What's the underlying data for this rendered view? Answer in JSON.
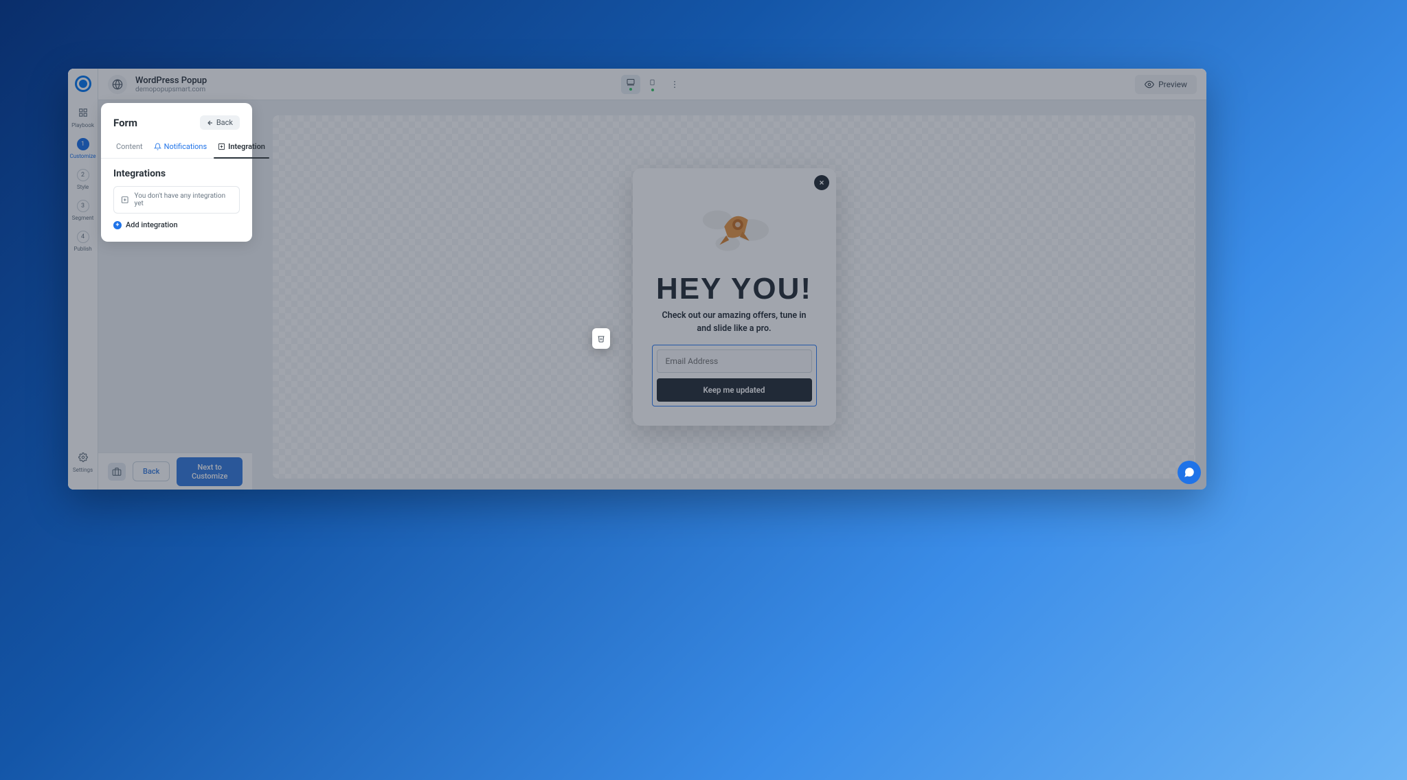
{
  "header": {
    "title": "WordPress Popup",
    "subtitle": "demopopupsmart.com",
    "preview": "Preview"
  },
  "rail": {
    "playbook": "Playbook",
    "steps": [
      {
        "num": "1",
        "label": "Customize"
      },
      {
        "num": "2",
        "label": "Style"
      },
      {
        "num": "3",
        "label": "Segment"
      },
      {
        "num": "4",
        "label": "Publish"
      }
    ],
    "settings": "Settings"
  },
  "panel": {
    "title": "Form",
    "back": "Back",
    "tabs": {
      "content": "Content",
      "notifications": "Notifications",
      "integration": "Integration"
    },
    "section": "Integrations",
    "empty": "You don't have any integration yet",
    "add": "Add integration"
  },
  "popup": {
    "heading": "HEY YOU!",
    "sub1": "Check out our amazing offers, tune in",
    "sub2": "and slide like a pro.",
    "email_placeholder": "Email Address",
    "cta": "Keep me updated"
  },
  "footer": {
    "back": "Back",
    "next": "Next to Customize"
  }
}
